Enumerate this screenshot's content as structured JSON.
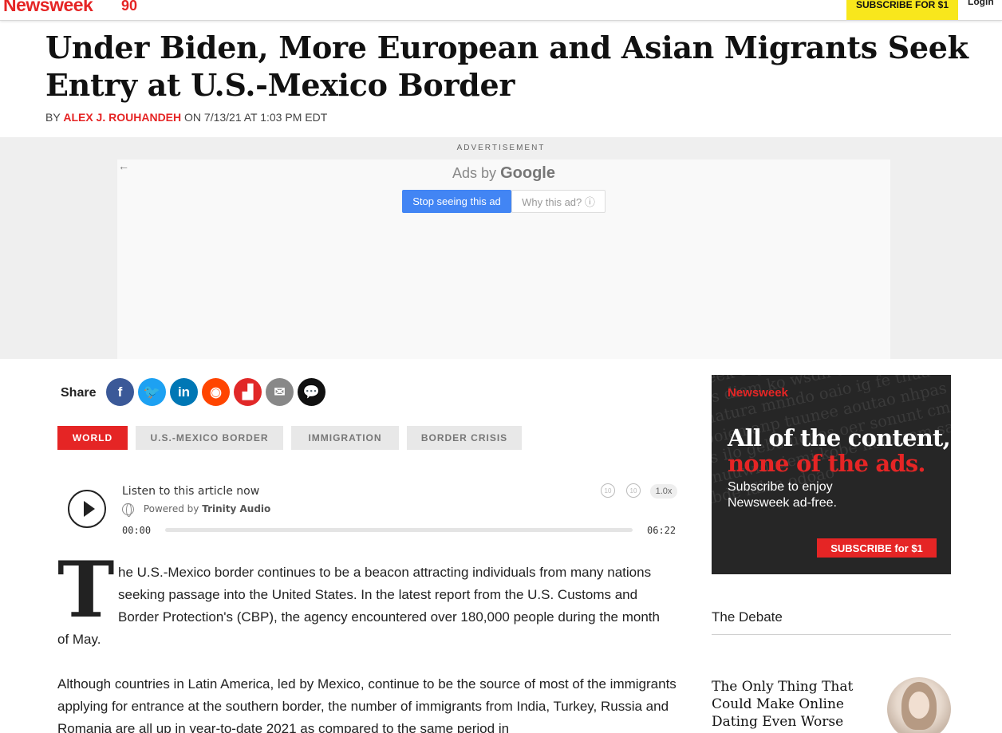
{
  "header": {
    "logo": "Newsweek",
    "logo_badge": "90",
    "subscribe_label": "SUBSCRIBE FOR $1",
    "login_label": "Login"
  },
  "article": {
    "headline": "Under Biden, More European and Asian Migrants Seek Entry at U.S.-Mexico Border",
    "byline_prefix": "BY",
    "author": "ALEX J. ROUHANDEH",
    "byline_suffix": "ON 7/13/21 AT 1:03 PM EDT",
    "dropcap": "T",
    "para1_lines": [
      "he U.S.-Mexico border continues to be a beacon attracting individuals from many nations",
      "seeking passage into the United States. In the latest report from the U.S. Customs and",
      "Border Protection's (CBP), the agency encountered over 180,000 people during the month",
      "of May."
    ],
    "para2": "Although countries in Latin America, led by Mexico, continue to be the source of most of the immigrants applying for entrance at the southern border, the number of immigrants from India, Turkey, Russia and Romania are all up in year-to-date 2021 as compared to the same period in"
  },
  "ad": {
    "label": "ADVERTISEMENT",
    "back_arrow": "←",
    "ads_by": "Ads by",
    "google": "Google",
    "stop_label": "Stop seeing this ad",
    "why_label": "Why this ad? ⓘ"
  },
  "share": {
    "label": "Share",
    "icons": [
      {
        "name": "facebook-icon",
        "glyph": "f",
        "color": "#3b5998"
      },
      {
        "name": "twitter-icon",
        "glyph": "🐦",
        "color": "#1da1f2"
      },
      {
        "name": "linkedin-icon",
        "glyph": "in",
        "color": "#0077b5"
      },
      {
        "name": "reddit-icon",
        "glyph": "◉",
        "color": "#ff4500"
      },
      {
        "name": "flipboard-icon",
        "glyph": "▟",
        "color": "#e12828"
      },
      {
        "name": "email-icon",
        "glyph": "✉",
        "color": "#888888"
      },
      {
        "name": "comment-icon",
        "glyph": "💬",
        "color": "#111111"
      }
    ]
  },
  "tags": [
    {
      "label": "WORLD",
      "active": true
    },
    {
      "label": "U.S.-MEXICO BORDER",
      "active": false
    },
    {
      "label": "IMMIGRATION",
      "active": false
    },
    {
      "label": "BORDER CRISIS",
      "active": false
    }
  ],
  "audio": {
    "listen_label": "Listen to this article now",
    "powered_prefix": "Powered by",
    "powered_brand": "Trinity Audio",
    "time_current": "00:00",
    "time_total": "06:22",
    "progress": 0,
    "rewind_label": "10",
    "forward_label": "10",
    "speed_label": "1.0x"
  },
  "promo": {
    "logo": "Newsweek",
    "headline_1": "All of the content,",
    "headline_2": "none of the ads.",
    "subtext": "Subscribe to enjoy Newsweek ad-free.",
    "button_label": "SUBSCRIBE for $1"
  },
  "debate": {
    "title": "The Debate",
    "item_title": "The Only Thing That Could Make Online Dating Even Worse"
  },
  "colors": {
    "brand_red": "#e52525",
    "subscribe_yellow": "#f8e71c",
    "google_blue": "#4285f4"
  }
}
